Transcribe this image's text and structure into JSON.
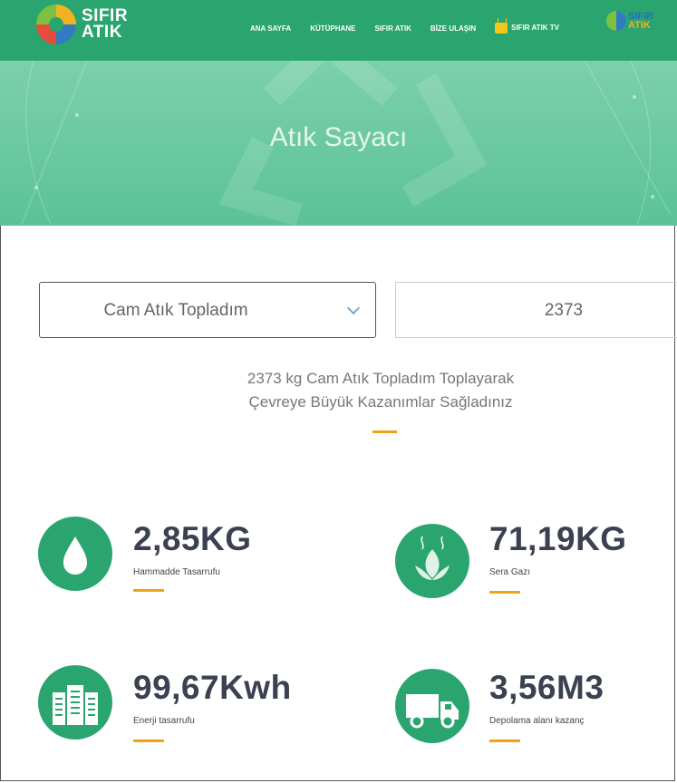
{
  "nav": {
    "logo_line1": "SIFIR",
    "logo_line2": "ATIK",
    "menu": [
      "ANA SAYFA",
      "KÜTÜPHANE",
      "SIFIR ATIK",
      "BİZE ULAŞIN",
      "SIFIR ATIK TV"
    ],
    "logo2_line1": "SIFIR",
    "logo2_line2": "ATIK"
  },
  "hero": {
    "title": "Atık Sayacı"
  },
  "form": {
    "waste_type": "Cam Atık Topladım",
    "amount": "2373"
  },
  "summary": {
    "line1": "2373 kg Cam Atık Topladım Toplayarak",
    "line2": "Çevreye Büyük Kazanımlar Sağladınız"
  },
  "stats": [
    {
      "value": "2,85KG",
      "label": "Hammadde Tasarrufu",
      "icon": "water-drop-icon"
    },
    {
      "value": "71,19KG",
      "label": "Sera Gazı",
      "icon": "leaf-icon"
    },
    {
      "value": "99,67Kwh",
      "label": "Enerji tasarrufu",
      "icon": "buildings-icon"
    },
    {
      "value": "3,56M3",
      "label": "Depolama alanı kazanç",
      "icon": "truck-icon"
    }
  ],
  "colors": {
    "green": "#2aa56f",
    "accent": "#f0a315",
    "text_dark": "#3b4150"
  }
}
